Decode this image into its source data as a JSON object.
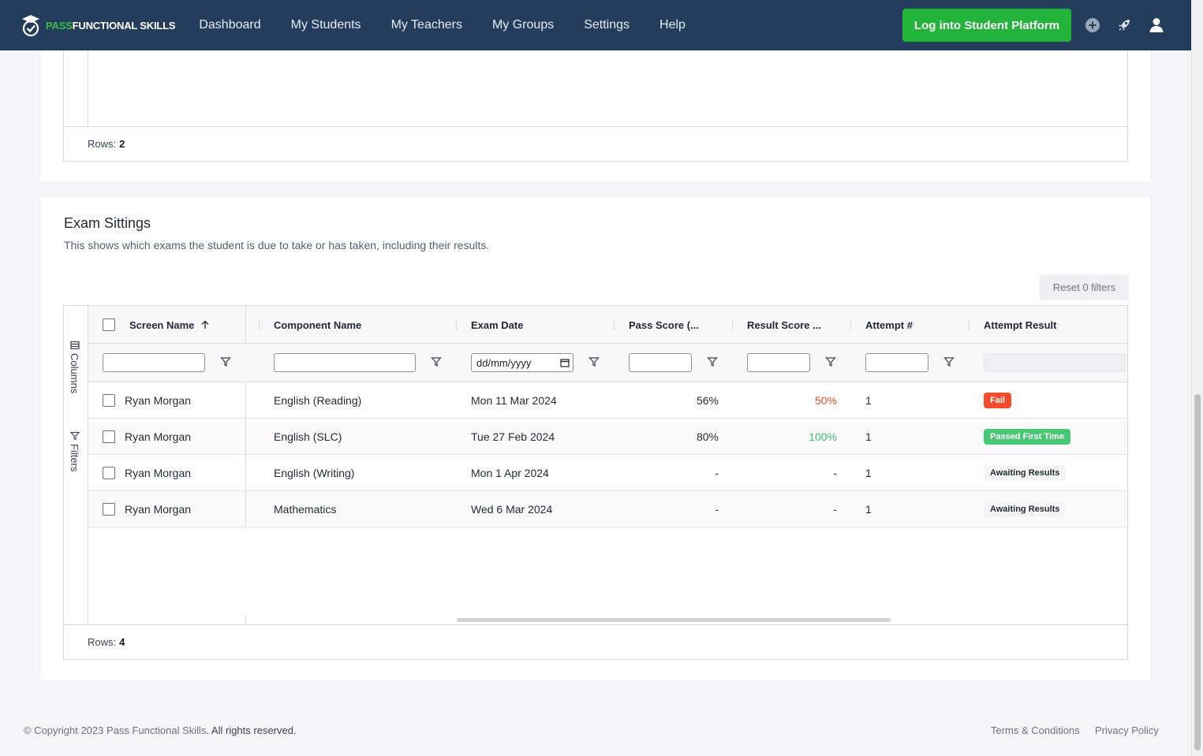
{
  "nav": {
    "logo_pass": "PASS",
    "logo_rest": "FUNCTIONAL SKILLS",
    "items": [
      "Dashboard",
      "My Students",
      "My Teachers",
      "My Groups",
      "Settings",
      "Help"
    ],
    "login_button": "Log into Student Platform"
  },
  "top_grid": {
    "rows_label": "Rows:",
    "rows_count": "2"
  },
  "exam_sittings": {
    "title": "Exam Sittings",
    "description": "This shows which exams the student is due to take or has taken, including their results.",
    "reset_button": "Reset 0 filters",
    "side_tabs": {
      "columns": "Columns",
      "filters": "Filters"
    },
    "columns": [
      "Screen Name",
      "Component Name",
      "Exam Date",
      "Pass Score (...",
      "Result Score ...",
      "Attempt #",
      "Attempt Result"
    ],
    "date_placeholder": "dd/mm/yyyy",
    "rows": [
      {
        "name": "Ryan Morgan",
        "component": "English (Reading)",
        "date": "Mon 11 Mar 2024",
        "pass": "56%",
        "result": "50%",
        "attempt": "1",
        "status": "Fail"
      },
      {
        "name": "Ryan Morgan",
        "component": "English (SLC)",
        "date": "Tue 27 Feb 2024",
        "pass": "80%",
        "result": "100%",
        "attempt": "1",
        "status": "Passed First Time"
      },
      {
        "name": "Ryan Morgan",
        "component": "English (Writing)",
        "date": "Mon 1 Apr 2024",
        "pass": "-",
        "result": "-",
        "attempt": "1",
        "status": "Awaiting Results"
      },
      {
        "name": "Ryan Morgan",
        "component": "Mathematics",
        "date": "Wed 6 Mar 2024",
        "pass": "-",
        "result": "-",
        "attempt": "1",
        "status": "Awaiting Results"
      }
    ],
    "rows_label": "Rows:",
    "rows_count": "4"
  },
  "colors": {
    "nav_bg": "#243d5c",
    "brand_green": "#22b43a",
    "fail_red": "#f44c2d",
    "pass_green": "#48c774"
  },
  "footer": {
    "copyright_prefix": "© Copyright 2023 Pass Functional Skills",
    "copyright_suffix": ". All rights reserved.",
    "terms": "Terms & Conditions",
    "privacy": "Privacy Policy"
  }
}
